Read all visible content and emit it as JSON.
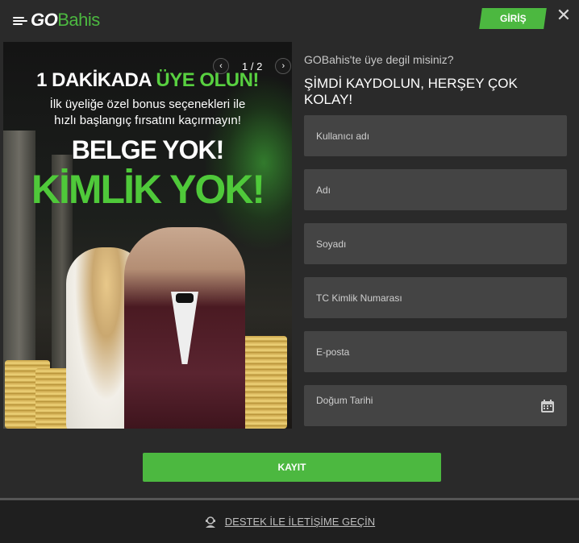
{
  "header": {
    "logo_go": "GO",
    "logo_bahis": "Bahis",
    "login_label": "GİRİŞ",
    "close_glyph": "✕"
  },
  "banner": {
    "prev_glyph": "‹",
    "next_glyph": "›",
    "counter": "1 / 2",
    "headline_a": "1 DAKİKADA ",
    "headline_b": "ÜYE OLUN!",
    "subtitle_line1": "İlk üyeliğe özel bonus seçenekleri ile",
    "subtitle_line2": "hızlı başlangıç fırsatını kaçırmayın!",
    "belge": "BELGE YOK!",
    "kimlik": "KİMLİK YOK!"
  },
  "form": {
    "question": "GOBahis'te üye degil misiniz?",
    "title": "ŞİMDİ KAYDOLUN, HERŞEY ÇOK KOLAY!",
    "fields": [
      {
        "placeholder": "Kullanıcı adı"
      },
      {
        "placeholder": "Adı"
      },
      {
        "placeholder": "Soyadı"
      },
      {
        "placeholder": "TC Kimlik Numarası"
      },
      {
        "placeholder": "E-posta"
      },
      {
        "placeholder": "Doğum Tarihi"
      }
    ],
    "submit_label": "KAYIT"
  },
  "support": {
    "label": "DESTEK İLE İLETİŞİME GEÇİN"
  },
  "colors": {
    "accent": "#4cb840",
    "background": "#2a2a2a",
    "field": "#444444"
  },
  "icons": [
    "close-icon",
    "chevron-left-icon",
    "chevron-right-icon",
    "calendar-icon",
    "support-agent-icon"
  ]
}
